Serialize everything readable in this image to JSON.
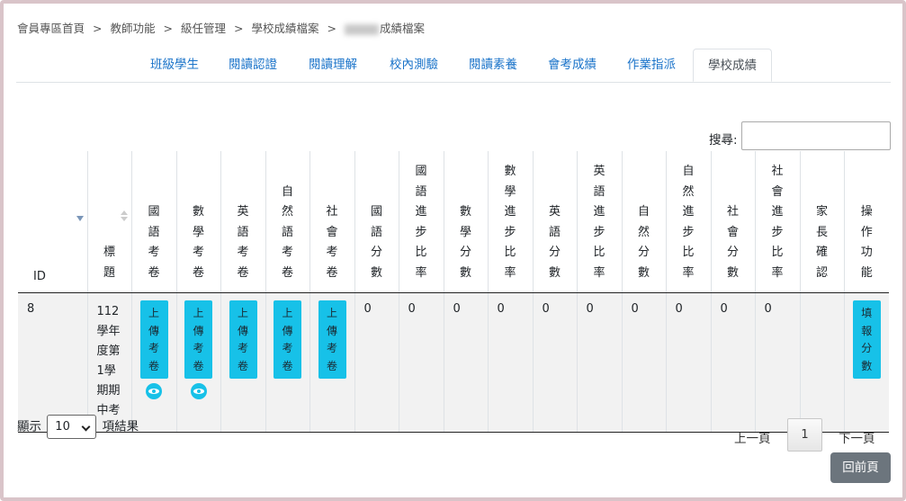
{
  "breadcrumb": {
    "items": [
      "會員專區首頁",
      "教師功能",
      "級任管理",
      "學校成績檔案",
      "成績檔案"
    ],
    "separator": ">"
  },
  "tabs": [
    "班級學生",
    "閱讀認證",
    "閱讀理解",
    "校內測驗",
    "閱讀素養",
    "會考成績",
    "作業指派",
    "學校成績"
  ],
  "active_tab": "學校成績",
  "search": {
    "label": "搜尋:",
    "value": ""
  },
  "table": {
    "headers": [
      "ID",
      "標題",
      "國語考卷",
      "數學考卷",
      "英語考卷",
      "自然語考卷",
      "社會考卷",
      "國語分數",
      "國語進步比率",
      "數學分數",
      "數學進步比率",
      "英語分數",
      "英語進步比率",
      "自然分數",
      "自然進步比率",
      "社會分數",
      "社會進步比率",
      "家長確認",
      "操作功能"
    ],
    "row": {
      "id": "8",
      "title": "112學年度第1學期期中考",
      "upload_label": "上傳考卷",
      "scores": [
        "0",
        "0",
        "0",
        "0",
        "0",
        "0",
        "0",
        "0",
        "0",
        "0"
      ],
      "parent_confirm": "",
      "action_label": "填報分數"
    }
  },
  "length_menu": {
    "prefix": "顯示",
    "value": "10",
    "suffix": "項結果"
  },
  "pagination": {
    "prev": "上一頁",
    "current": "1",
    "next": "下一頁"
  },
  "back_button": "回前頁",
  "colors": {
    "accent": "#17c1e8",
    "link": "#1a73c9",
    "back_button": "#6c757d"
  }
}
